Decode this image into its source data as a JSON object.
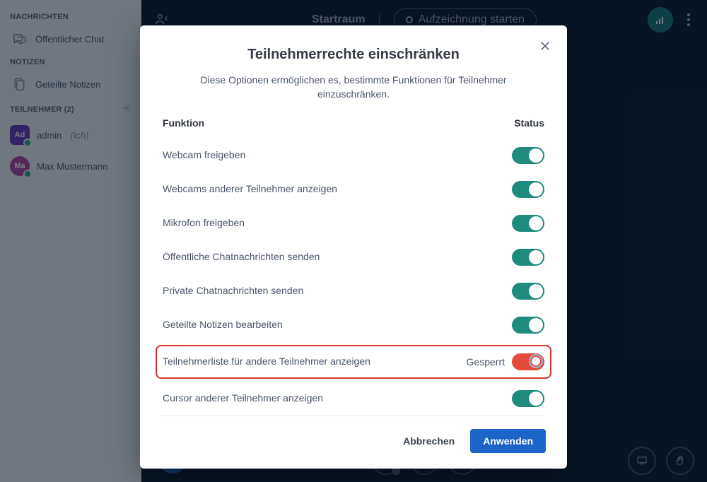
{
  "topbar": {
    "room": "Startraum",
    "record": "Aufzeichnung starten"
  },
  "sidebar": {
    "sections": {
      "messages": "NACHRICHTEN",
      "notes": "NOTIZEN",
      "participants_prefix": "TEILNEHMER",
      "participants_count": "(2)"
    },
    "public_chat": "Öffentlicher Chat",
    "shared_notes": "Geteilte Notizen",
    "participants": [
      {
        "initials": "Ad",
        "name": "admin",
        "suffix": "(Ich)",
        "color": "#6a3bbf",
        "shape": "sq"
      },
      {
        "initials": "Ma",
        "name": "Max Mustermann",
        "suffix": "",
        "color": "#b04aa0",
        "shape": "rd"
      }
    ]
  },
  "modal": {
    "title": "Teilnehmerrechte einschränken",
    "subtitle": "Diese Optionen ermöglichen es, bestimmte Funktionen für Teilnehmer einzuschränken.",
    "col_function": "Funktion",
    "col_status": "Status",
    "locked_label": "Gesperrt",
    "rows": [
      {
        "label": "Webcam freigeben",
        "on": true,
        "highlight": false
      },
      {
        "label": "Webcams anderer Teilnehmer anzeigen",
        "on": true,
        "highlight": false
      },
      {
        "label": "Mikrofon freigeben",
        "on": true,
        "highlight": false
      },
      {
        "label": "Öffentliche Chatnachrichten senden",
        "on": true,
        "highlight": false
      },
      {
        "label": "Private Chatnachrichten senden",
        "on": true,
        "highlight": false
      },
      {
        "label": "Geteilte Notizen bearbeiten",
        "on": true,
        "highlight": false
      },
      {
        "label": "Teilnehmerliste für andere Teilnehmer anzeigen",
        "on": false,
        "highlight": true
      },
      {
        "label": "Cursor anderer Teilnehmer anzeigen",
        "on": true,
        "highlight": false
      }
    ],
    "cancel": "Abbrechen",
    "apply": "Anwenden"
  }
}
